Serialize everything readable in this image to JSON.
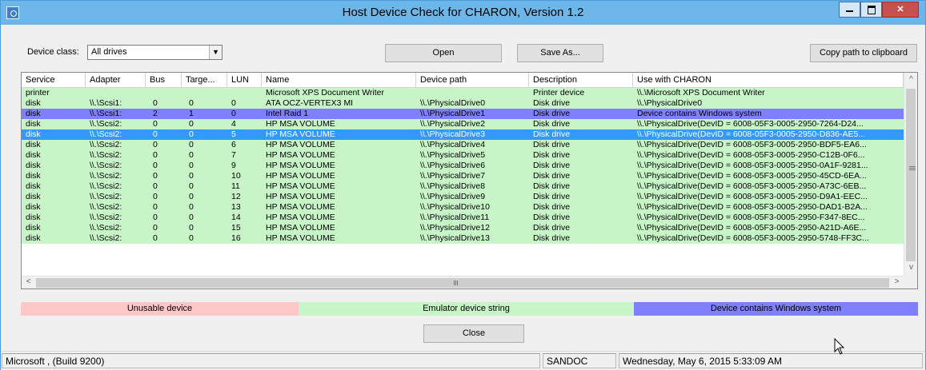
{
  "window": {
    "title": "Host Device Check for CHARON, Version 1.2"
  },
  "controls": {
    "device_class_label": "Device class:",
    "device_class_value": "All drives",
    "open_label": "Open",
    "save_as_label": "Save As...",
    "copy_label": "Copy path to clipboard",
    "close_label": "Close"
  },
  "table": {
    "columns": [
      "Service",
      "Adapter",
      "Bus",
      "Targe...",
      "LUN",
      "Name",
      "Device path",
      "Description",
      "Use with CHARON"
    ],
    "rows": [
      {
        "type": "normal",
        "cells": [
          "printer",
          "",
          "",
          "",
          "",
          "Microsoft XPS Document Writer",
          "",
          "Printer device",
          "\\\\.\\Microsoft XPS Document Writer"
        ]
      },
      {
        "type": "normal",
        "cells": [
          "disk",
          "\\\\.\\Scsi1:",
          "0",
          "0",
          "0",
          "ATA OCZ-VERTEX3 MI",
          "\\\\.\\PhysicalDrive0",
          "Disk drive",
          "\\\\.\\PhysicalDrive0"
        ]
      },
      {
        "type": "sys",
        "cells": [
          "disk",
          "\\\\.\\Scsi1:",
          "2",
          "1",
          "0",
          "Intel Raid 1",
          "\\\\.\\PhysicalDrive1",
          "Disk drive",
          "Device contains Windows system"
        ]
      },
      {
        "type": "normal",
        "cells": [
          "disk",
          "\\\\.\\Scsi2:",
          "0",
          "0",
          "4",
          "HP MSA VOLUME",
          "\\\\.\\PhysicalDrive2",
          "Disk drive",
          "\\\\.\\PhysicalDrive(DevID = 6008-05F3-0005-2950-7264-D24..."
        ]
      },
      {
        "type": "sel",
        "cells": [
          "disk",
          "\\\\.\\Scsi2:",
          "0",
          "0",
          "5",
          "HP MSA VOLUME",
          "\\\\.\\PhysicalDrive3",
          "Disk drive",
          "\\\\.\\PhysicalDrive(DevID = 6008-05F3-0005-2950-D836-AE5..."
        ]
      },
      {
        "type": "normal",
        "cells": [
          "disk",
          "\\\\.\\Scsi2:",
          "0",
          "0",
          "6",
          "HP MSA VOLUME",
          "\\\\.\\PhysicalDrive4",
          "Disk drive",
          "\\\\.\\PhysicalDrive(DevID = 6008-05F3-0005-2950-BDF5-EA6..."
        ]
      },
      {
        "type": "normal",
        "cells": [
          "disk",
          "\\\\.\\Scsi2:",
          "0",
          "0",
          "7",
          "HP MSA VOLUME",
          "\\\\.\\PhysicalDrive5",
          "Disk drive",
          "\\\\.\\PhysicalDrive(DevID = 6008-05F3-0005-2950-C12B-0F6..."
        ]
      },
      {
        "type": "normal",
        "cells": [
          "disk",
          "\\\\.\\Scsi2:",
          "0",
          "0",
          "9",
          "HP MSA VOLUME",
          "\\\\.\\PhysicalDrive6",
          "Disk drive",
          "\\\\.\\PhysicalDrive(DevID = 6008-05F3-0005-2950-0A1F-9281..."
        ]
      },
      {
        "type": "normal",
        "cells": [
          "disk",
          "\\\\.\\Scsi2:",
          "0",
          "0",
          "10",
          "HP MSA VOLUME",
          "\\\\.\\PhysicalDrive7",
          "Disk drive",
          "\\\\.\\PhysicalDrive(DevID = 6008-05F3-0005-2950-45CD-6EA..."
        ]
      },
      {
        "type": "normal",
        "cells": [
          "disk",
          "\\\\.\\Scsi2:",
          "0",
          "0",
          "11",
          "HP MSA VOLUME",
          "\\\\.\\PhysicalDrive8",
          "Disk drive",
          "\\\\.\\PhysicalDrive(DevID = 6008-05F3-0005-2950-A73C-6EB..."
        ]
      },
      {
        "type": "normal",
        "cells": [
          "disk",
          "\\\\.\\Scsi2:",
          "0",
          "0",
          "12",
          "HP MSA VOLUME",
          "\\\\.\\PhysicalDrive9",
          "Disk drive",
          "\\\\.\\PhysicalDrive(DevID = 6008-05F3-0005-2950-D9A1-EEC..."
        ]
      },
      {
        "type": "normal",
        "cells": [
          "disk",
          "\\\\.\\Scsi2:",
          "0",
          "0",
          "13",
          "HP MSA VOLUME",
          "\\\\.\\PhysicalDrive10",
          "Disk drive",
          "\\\\.\\PhysicalDrive(DevID = 6008-05F3-0005-2950-DAD1-B2A..."
        ]
      },
      {
        "type": "normal",
        "cells": [
          "disk",
          "\\\\.\\Scsi2:",
          "0",
          "0",
          "14",
          "HP MSA VOLUME",
          "\\\\.\\PhysicalDrive11",
          "Disk drive",
          "\\\\.\\PhysicalDrive(DevID = 6008-05F3-0005-2950-F347-8EC..."
        ]
      },
      {
        "type": "normal",
        "cells": [
          "disk",
          "\\\\.\\Scsi2:",
          "0",
          "0",
          "15",
          "HP MSA VOLUME",
          "\\\\.\\PhysicalDrive12",
          "Disk drive",
          "\\\\.\\PhysicalDrive(DevID = 6008-05F3-0005-2950-A21D-A6E..."
        ]
      },
      {
        "type": "normal",
        "cells": [
          "disk",
          "\\\\.\\Scsi2:",
          "0",
          "0",
          "16",
          "HP MSA VOLUME",
          "\\\\.\\PhysicalDrive13",
          "Disk drive",
          "\\\\.\\PhysicalDrive(DevID = 6008-05F3-0005-2950-5748-FF3C..."
        ]
      }
    ]
  },
  "legend": {
    "unusable": "Unusable device",
    "emulator": "Emulator device string",
    "system": "Device contains Windows system"
  },
  "colors": {
    "unusable": "#ffc8c8",
    "emulator": "#c8f5c8",
    "system": "#8080ff",
    "selected": "#3399ff"
  },
  "status": {
    "os": "Microsoft ,  (Build 9200)",
    "host": "SANDOC",
    "datetime": "Wednesday, May 6, 2015 5:33:09 AM"
  }
}
